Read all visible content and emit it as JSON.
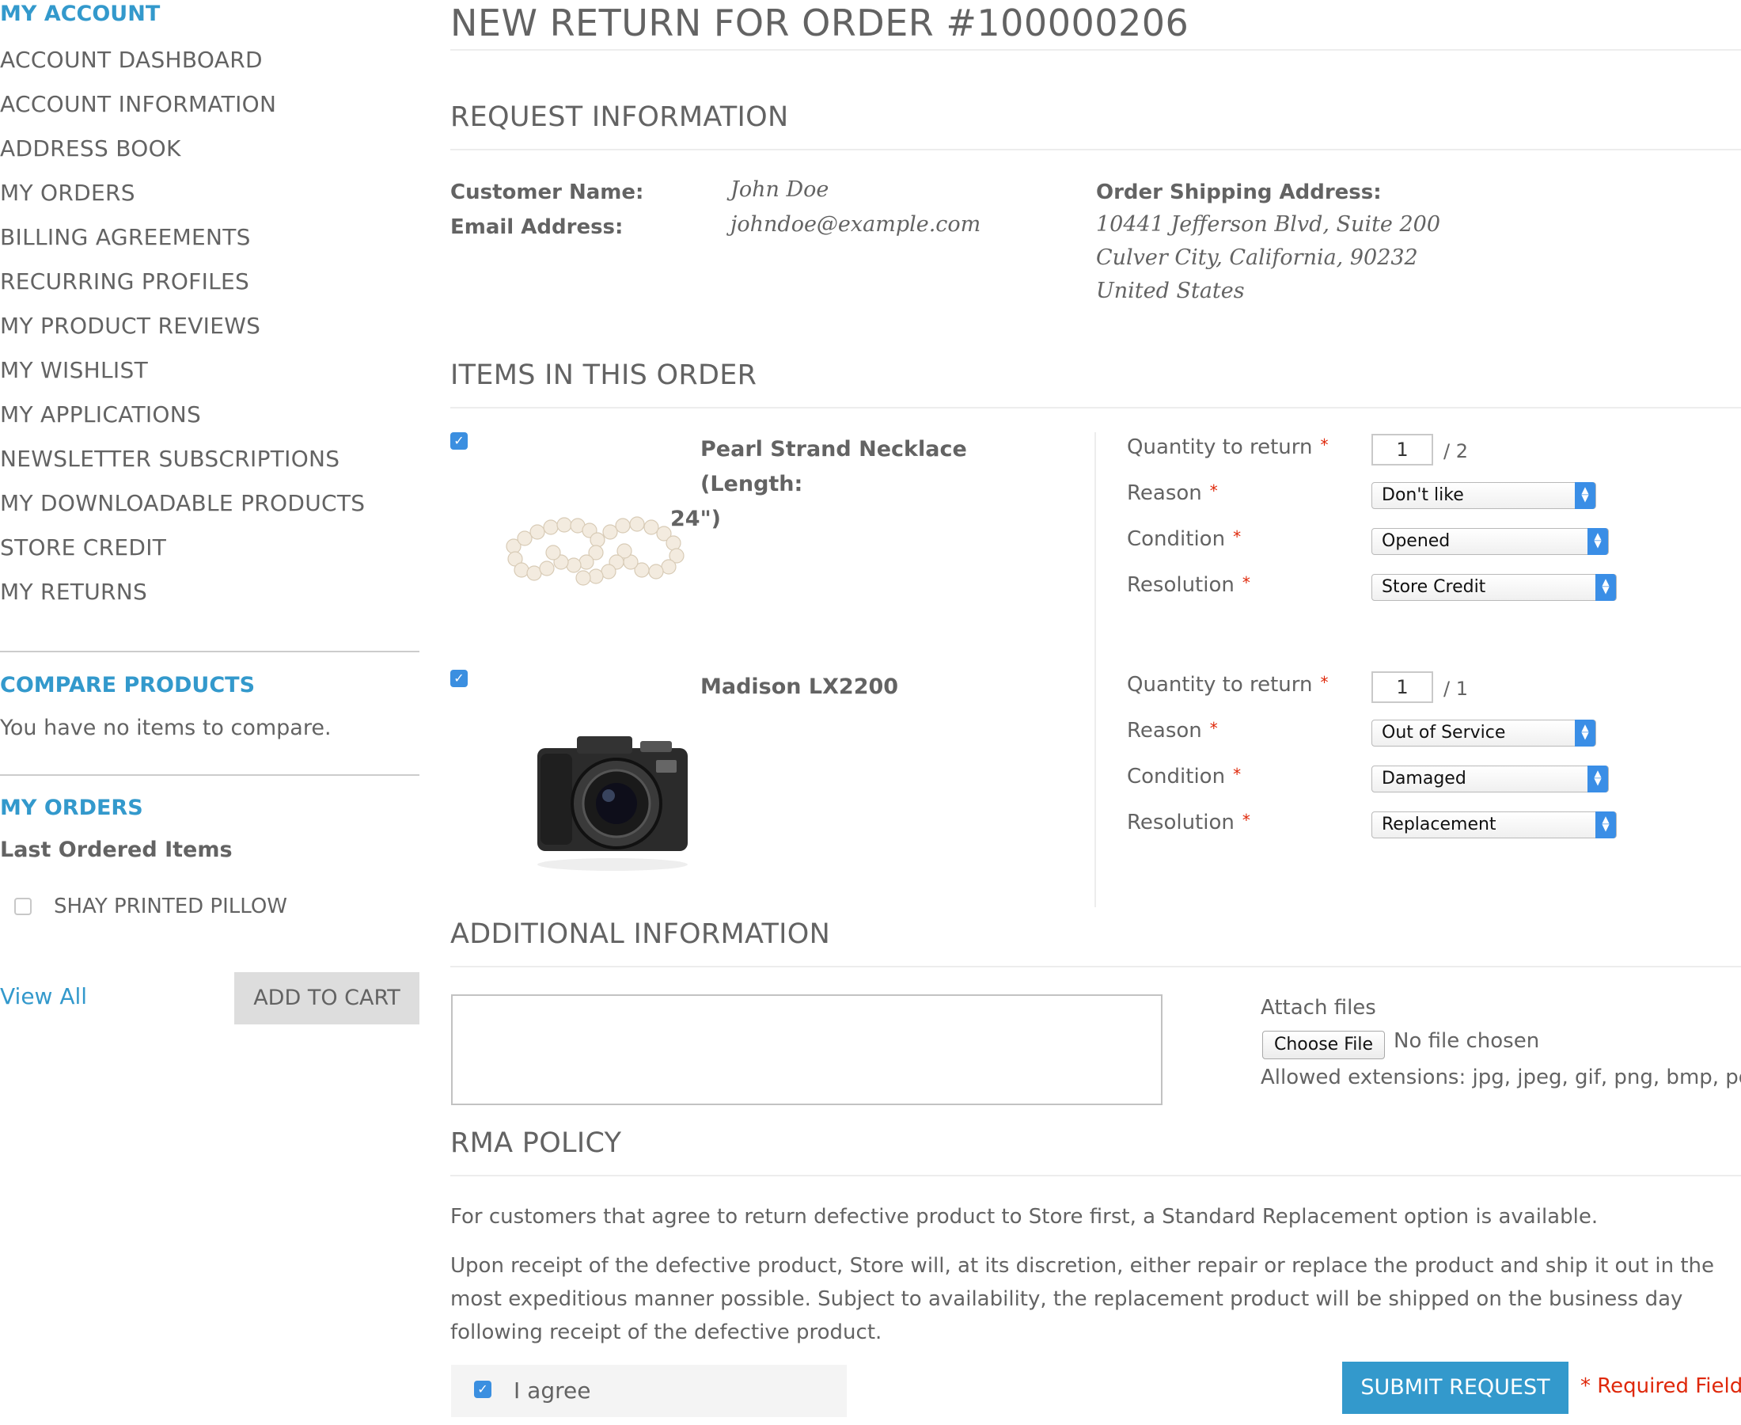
{
  "sidebar": {
    "account_title": "MY ACCOUNT",
    "nav": [
      "ACCOUNT DASHBOARD",
      "ACCOUNT INFORMATION",
      "ADDRESS BOOK",
      "MY ORDERS",
      "BILLING AGREEMENTS",
      "RECURRING PROFILES",
      "MY PRODUCT REVIEWS",
      "MY WISHLIST",
      "MY APPLICATIONS",
      "NEWSLETTER SUBSCRIPTIONS",
      "MY DOWNLOADABLE PRODUCTS",
      "STORE CREDIT",
      "MY RETURNS"
    ],
    "compare": {
      "title": "COMPARE PRODUCTS",
      "empty_text": "You have no items to compare."
    },
    "orders": {
      "title": "MY ORDERS",
      "subtitle": "Last Ordered Items",
      "item": "SHAY PRINTED PILLOW",
      "view_all": "View All",
      "add_to_cart": "ADD TO CART"
    }
  },
  "main": {
    "page_title": "NEW RETURN FOR ORDER #100000206",
    "request_info": {
      "title": "REQUEST INFORMATION",
      "customer_name_label": "Customer Name:",
      "customer_name": "John Doe",
      "email_label": "Email Address:",
      "email": "johndoe@example.com",
      "shipping_label": "Order Shipping Address:",
      "address_line1": "10441 Jefferson Blvd, Suite 200",
      "address_line2": "Culver City, California, 90232",
      "address_line3": "United States"
    },
    "items": {
      "title": "ITEMS IN THIS ORDER",
      "list": [
        {
          "name_line1": "Pearl Strand Necklace (Length:",
          "name_line2": "24\")",
          "checked": true,
          "qty_label": "Quantity to return",
          "qty_value": "1",
          "qty_max": "/ 2",
          "reason_label": "Reason",
          "reason": "Don't like",
          "condition_label": "Condition",
          "condition": "Opened",
          "resolution_label": "Resolution",
          "resolution": "Store Credit"
        },
        {
          "name_line1": "Madison LX2200",
          "name_line2": "",
          "checked": true,
          "qty_label": "Quantity to return",
          "qty_value": "1",
          "qty_max": "/ 1",
          "reason_label": "Reason",
          "reason": "Out of Service",
          "condition_label": "Condition",
          "condition": "Damaged",
          "resolution_label": "Resolution",
          "resolution": "Replacement"
        }
      ]
    },
    "additional": {
      "title": "ADDITIONAL INFORMATION",
      "attach_label": "Attach files",
      "choose_file": "Choose File",
      "no_file": "No file chosen",
      "allowed": "Allowed extensions: jpg, jpeg, gif, png, bmp, pdf"
    },
    "policy": {
      "title": "RMA POLICY",
      "para1": "For customers that agree to return defective product to Store first, a Standard Replacement option is available.",
      "para2": "Upon receipt of the defective product, Store will, at its discretion, either repair or replace the product and ship it out in the most expeditious manner possible. Subject to availability, the replacement product will be shipped on the business day following receipt of the defective product.",
      "agree": "I agree",
      "submit": "SUBMIT REQUEST",
      "required": "* Required Fields"
    }
  },
  "colors": {
    "accent": "#3399cc",
    "required": "#df280a",
    "text": "#636363",
    "checkbox": "#3b8fe0"
  }
}
